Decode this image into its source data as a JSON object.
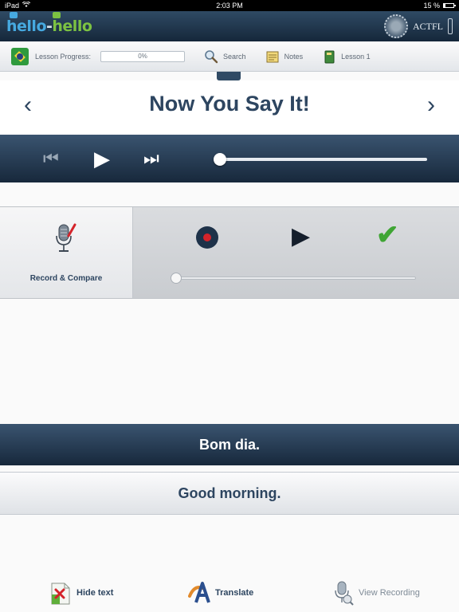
{
  "status_bar": {
    "device": "iPad",
    "time": "2:03 PM",
    "battery": "15 %"
  },
  "header": {
    "logo": {
      "part1": "hello",
      "dash": "-",
      "part2": "hello"
    },
    "partner": "ACTFL"
  },
  "toolbar": {
    "progress_label": "Lesson Progress:",
    "progress_value": "0%",
    "progress_fraction": 0,
    "search_label": "Search",
    "notes_label": "Notes",
    "lesson_label": "Lesson 1"
  },
  "screen": {
    "title": "Now You Say It!",
    "prev_glyph": "‹",
    "next_glyph": "›"
  },
  "player": {
    "skip_back_glyph": "⏮",
    "play_glyph": "▶",
    "skip_fwd_glyph": "⏭",
    "position_fraction": 0
  },
  "record": {
    "label": "Record & Compare",
    "play_glyph": "▶",
    "check_glyph": "✔",
    "position_fraction": 0
  },
  "phrase": {
    "target": "Bom dia.",
    "translation": "Good morning."
  },
  "bottom": {
    "hide_text": "Hide text",
    "translate": "Translate",
    "view_recording": "View Recording"
  },
  "colors": {
    "navy": "#2d4560",
    "brand_blue": "#46a9e0",
    "brand_green": "#7cc242",
    "record_red": "#d4232a",
    "check_green": "#3fa534"
  }
}
